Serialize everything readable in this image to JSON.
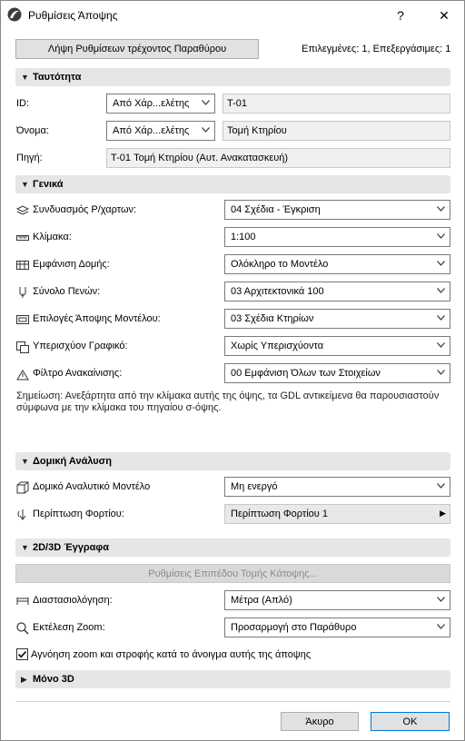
{
  "window": {
    "title": "Ρυθμίσεις Άποψης",
    "help": "?",
    "close": "✕"
  },
  "top": {
    "get_settings_button": "Λήψη Ρυθμίσεων τρέχοντος Παραθύρου",
    "selection_status": "Επιλεγμένες: 1, Επεξεργάσιμες: 1"
  },
  "identity": {
    "header": "Ταυτότητα",
    "id_label": "ID:",
    "id_source": "Από Χάρ...ελέτης",
    "id_value": "T-01",
    "name_label": "Όνομα:",
    "name_source": "Από Χάρ...ελέτης",
    "name_value": "Τομή Κτηρίου",
    "source_label": "Πηγή:",
    "source_value": "T-01 Τομή Κτηρίου (Αυτ. Ανακατασκευή)"
  },
  "general": {
    "header": "Γενικά",
    "rows": [
      {
        "label": "Συνδυασμός Ρ/χαρτων:",
        "value": "04 Σχέδια - Έγκριση",
        "icon": "layers-icon"
      },
      {
        "label": "Κλίμακα:",
        "value": "1:100",
        "icon": "ruler-icon"
      },
      {
        "label": "Εμφάνιση Δομής:",
        "value": "Ολόκληρο το Μοντέλο",
        "icon": "structure-display-icon"
      },
      {
        "label": "Σύνολο Πενών:",
        "value": "03 Αρχιτεκτονικά 100",
        "icon": "pen-set-icon"
      },
      {
        "label": "Επιλογές Άποψης Μοντέλου:",
        "value": "03 Σχέδια Κτηρίων",
        "icon": "model-view-options-icon"
      },
      {
        "label": "Υπερισχύον Γραφικό:",
        "value": "Χωρίς Υπερισχύοντα",
        "icon": "graphic-override-icon"
      },
      {
        "label": "Φίλτρο Ανακαίνισης:",
        "value": "00 Εμφάνιση Όλων των Στοιχείων",
        "icon": "renovation-filter-icon"
      }
    ],
    "note": "Σημείωση: Ανεξάρτητα από την κλίμακα αυτής της όψης, τα GDL αντικείμενα θα παρουσιαστούν σύμφωνα με την κλίμακα του πηγαίου σ-όψης."
  },
  "structural": {
    "header": "Δομική Ανάλυση",
    "model_label": "Δομικό Αναλυτικό Μοντέλο",
    "model_value": "Μη ενεργό",
    "load_label": "Περίπτωση Φορτίου:",
    "load_value": "Περίπτωση Φορτίου 1"
  },
  "docs": {
    "header": "2D/3D Έγγραφα",
    "floor_plan_button": "Ρυθμίσεις Επιπέδου Τομής Κάτοψης...",
    "dimension_label": "Διαστασιολόγηση:",
    "dimension_value": "Μέτρα (Απλό)",
    "zoom_label": "Εκτέλεση Zoom:",
    "zoom_value": "Προσαρμογή στο Παράθυρο",
    "ignore_zoom_label": "Αγνόηση zoom και στροφής κατά το άνοιγμα αυτής της άποψης",
    "ignore_zoom_checked": true
  },
  "only3d": {
    "header": "Μόνο 3D"
  },
  "footer": {
    "cancel": "Άκυρο",
    "ok": "OK"
  }
}
